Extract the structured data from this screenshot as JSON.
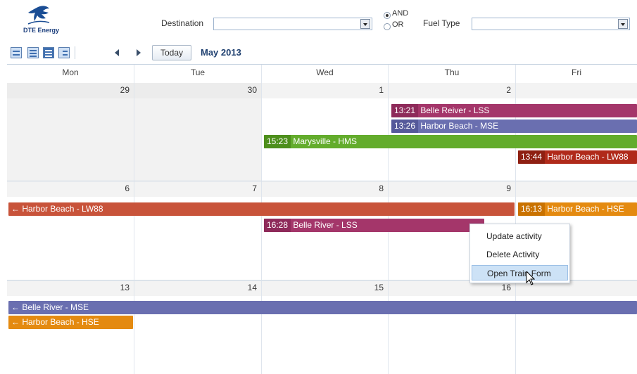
{
  "brand": {
    "logo_text": "DTE Energy"
  },
  "filters": {
    "destination_label": "Destination",
    "destination_value": "",
    "logic_and": "AND",
    "logic_or": "OR",
    "fuel_type_label": "Fuel Type",
    "fuel_type_value": ""
  },
  "toolbar": {
    "today_label": "Today",
    "month_label": "May 2013"
  },
  "calendar": {
    "day_headers": [
      "Mon",
      "Tue",
      "Wed",
      "Thu",
      "Fri"
    ],
    "weeks": [
      {
        "days": [
          "29",
          "30",
          "1",
          "2",
          ""
        ]
      },
      {
        "days": [
          "6",
          "7",
          "8",
          "9",
          ""
        ]
      },
      {
        "days": [
          "13",
          "14",
          "15",
          "16",
          ""
        ]
      }
    ],
    "events": [
      {
        "time": "13:21",
        "title": "Belle Reiver - LSS",
        "color": "#a4366a"
      },
      {
        "time": "13:26",
        "title": "Harbor Beach - MSE",
        "color": "#6a6fb0"
      },
      {
        "time": "15:23",
        "title": "Marysville - HMS",
        "color": "#5fa82a"
      },
      {
        "time": "13:44",
        "title": "Harbor Beach - LW88",
        "color": "#b02a1a"
      },
      {
        "time": "",
        "title": "Harbor Beach - LW88",
        "color": "#c8533a"
      },
      {
        "time": "16:13",
        "title": "Harbor Beach - HSE",
        "color": "#e48a10"
      },
      {
        "time": "16:28",
        "title": "Belle River - LSS",
        "color": "#a4366a"
      },
      {
        "time": "",
        "title": "Belle River - MSE",
        "color": "#6a6fb0"
      },
      {
        "time": "",
        "title": "Harbor Beach - HSE",
        "color": "#e48a10"
      }
    ]
  },
  "context_menu": {
    "items": [
      "Update activity",
      "Delete Activity",
      "Open Train Form"
    ]
  }
}
